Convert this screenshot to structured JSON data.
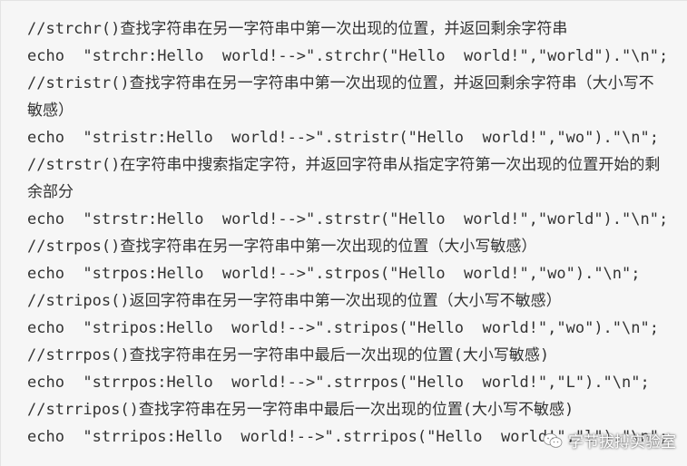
{
  "lines": [
    "//strchr()查找字符串在另一字符串中第一次出现的位置，并返回剩余字符串",
    "echo  \"strchr:Hello  world!-->\".strchr(\"Hello  world!\",\"world\").\"\\n\";",
    "//stristr()查找字符串在另一字符串中第一次出现的位置，并返回剩余字符串（大小写不敏感）",
    "echo  \"stristr:Hello  world!-->\".stristr(\"Hello  world!\",\"wo\").\"\\n\";",
    "//strstr()在字符串中搜索指定字符，并返回字符串从指定字符第一次出现的位置开始的剩余部分",
    "echo  \"strstr:Hello  world!-->\".strstr(\"Hello  world!\",\"world\").\"\\n\";",
    "//strpos()查找字符串在另一字符串中第一次出现的位置（大小写敏感）",
    "echo  \"strpos:Hello  world!-->\".strpos(\"Hello  world!\",\"wo\").\"\\n\";",
    "//stripos()返回字符串在另一字符串中第一次出现的位置（大小写不敏感）",
    "echo  \"stripos:Hello  world!-->\".stripos(\"Hello  world!\",\"wo\").\"\\n\";",
    "//strrpos()查找字符串在另一字符串中最后一次出现的位置(大小写敏感)",
    "echo  \"strrpos:Hello  world!-->\".strrpos(\"Hello  world!\",\"L\").\"\\n\";",
    "//strripos()查找字符串在另一字符串中最后一次出现的位置(大小写不敏感)",
    "echo  \"strripos:Hello  world!-->\".strripos(\"Hello  world!\",\"l\").\"\\n\";"
  ],
  "watermark": {
    "text": "字节拔搏实验室",
    "icon": "wechat-icon"
  }
}
